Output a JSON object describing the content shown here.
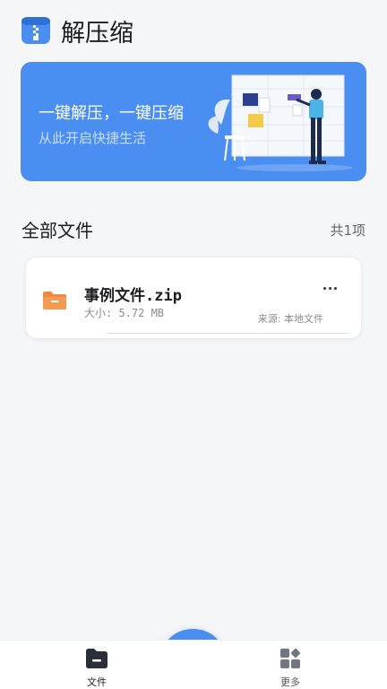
{
  "app": {
    "title": "解压缩"
  },
  "banner": {
    "title": "一键解压，一键压缩",
    "subtitle": "从此开启快捷生活"
  },
  "section": {
    "title": "全部文件",
    "count": "共1项"
  },
  "files": [
    {
      "name": "事例文件.zip",
      "size": "大小: 5.72 MB",
      "source": "来源: 本地文件",
      "icon": "folder-icon"
    }
  ],
  "nav": {
    "files_label": "文件",
    "more_label": "更多"
  },
  "colors": {
    "accent": "#4a8ef2",
    "folder": "#f0883e"
  }
}
